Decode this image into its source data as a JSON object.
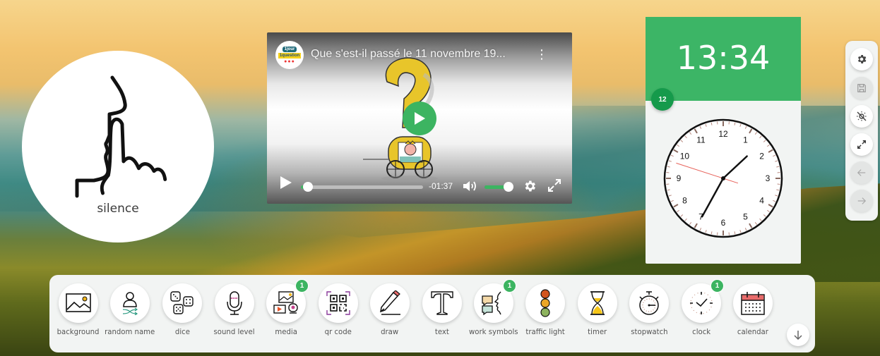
{
  "symbol": {
    "label": "silence",
    "icon": "silence-gesture-icon"
  },
  "video": {
    "title": "Que s'est-il passé le 11 novembre 19...",
    "channel_logo": {
      "line1": "1jour",
      "line2": "1question",
      "dots": "●●●"
    },
    "time_remaining": "-01:37",
    "progress_fraction": 0.06,
    "volume_fraction": 0.85,
    "controls": [
      "play",
      "volume",
      "settings",
      "fullscreen"
    ],
    "accent_color": "#3cb461"
  },
  "clock": {
    "digital_time": "13:34",
    "badge": "12",
    "analog": {
      "hour": 13,
      "minute": 34,
      "second": 48
    },
    "numbers": [
      "12",
      "1",
      "2",
      "3",
      "4",
      "5",
      "6",
      "7",
      "8",
      "9",
      "10",
      "11"
    ],
    "header_color": "#3cb566"
  },
  "side_toolbar": {
    "buttons": [
      {
        "name": "settings",
        "state": "active"
      },
      {
        "name": "save",
        "state": "disabled"
      },
      {
        "name": "hide-widgets",
        "state": "active"
      },
      {
        "name": "fullscreen",
        "state": "active"
      },
      {
        "name": "undo",
        "state": "disabled"
      },
      {
        "name": "redo",
        "state": "disabled"
      }
    ]
  },
  "dock": {
    "items": [
      {
        "label": "background",
        "badge": null
      },
      {
        "label": "random name",
        "badge": null
      },
      {
        "label": "dice",
        "badge": null
      },
      {
        "label": "sound level",
        "badge": null
      },
      {
        "label": "media",
        "badge": "1"
      },
      {
        "label": "qr code",
        "badge": null
      },
      {
        "label": "draw",
        "badge": null
      },
      {
        "label": "text",
        "badge": null
      },
      {
        "label": "work symbols",
        "badge": "1"
      },
      {
        "label": "traffic light",
        "badge": null
      },
      {
        "label": "timer",
        "badge": null
      },
      {
        "label": "stopwatch",
        "badge": null
      },
      {
        "label": "clock",
        "badge": "1"
      },
      {
        "label": "calendar",
        "badge": null
      }
    ],
    "scroll_icon": "arrow-down-icon"
  }
}
